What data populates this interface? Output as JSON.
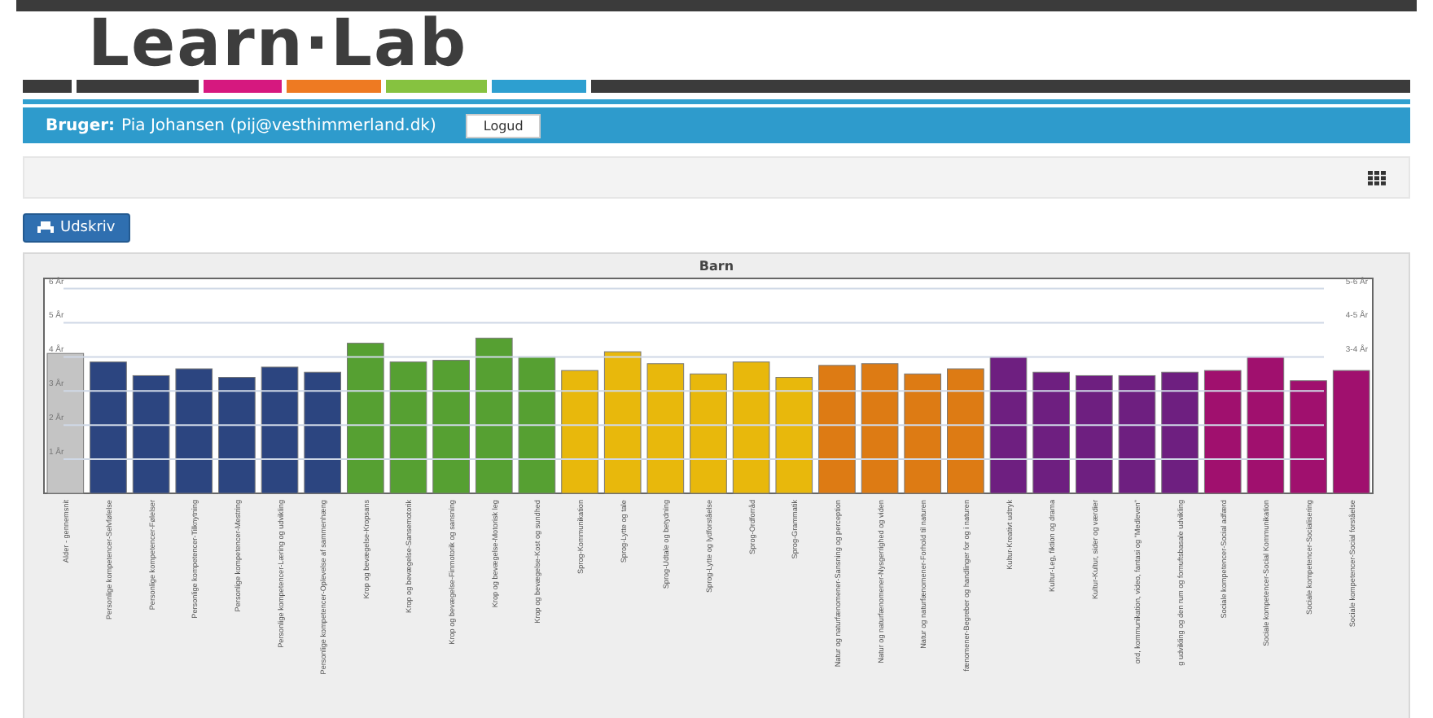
{
  "logo": {
    "text": "Learn·Lab"
  },
  "user_bar": {
    "label": "Bruger:",
    "user": "Pia Johansen (pij@vesthimmerland.dk)",
    "logout_button": "Logud"
  },
  "print_button": {
    "label": "Udskriv"
  },
  "chart_panel": {
    "right_labels": [
      "5-6 År",
      "4-5 År",
      "3-4 År"
    ],
    "chart_data": {
      "type": "bar",
      "title": "Barn",
      "categories": [
        "Alder - gennemsnit",
        "Personlige kompetencer-Selvfølelse",
        "Personlige kompetencer-Følelser",
        "Personlige kompetencer-Tilknytning",
        "Personlige kompetencer-Mestring",
        "Personlige kompetencer-Læring og udvikling",
        "Personlige kompetencer-Oplevelse af sammenhæng",
        "Krop og bevægelse-Kropsans",
        "Krop og bevægelse-Sansemotorik",
        "Krop og bevægelse-Finmotorik og sansning",
        "Krop og bevægelse-Motorisk leg",
        "Krop og bevægelse-Kost og sundhed",
        "Sprog-Kommunikation",
        "Sprog-Lytte og tale",
        "Sprog-Udtale og betydning",
        "Sprog-Lytte og lydforståelse",
        "Sprog-Ordforråd",
        "Sprog-Grammatik",
        "Natur og naturfænomener-Sansning og perception",
        "Natur og naturfænomener-Nysgerrighed og viden",
        "Natur og naturfænomener-Forhold til naturen",
        "fænomener-Begreber og handlinger for og i naturen",
        "Kultur-Kreativt udtryk",
        "Kultur-Leg, fiktion og drama",
        "Kultur-Kultur, sider og værdier",
        "ord, kommunikation, video, fantasi og \"Medleven\"",
        "g udvikling og den rum og fornuftsbasale udvikling",
        "Sociale kompetencer-Social adfærd",
        "Sociale kompetencer-Social Kommunikation",
        "Sociale kompetencer-Socialisering",
        "Sociale kompetencer-Social forståelse"
      ],
      "ylim": [
        0,
        6.3
      ],
      "yticks": [
        {
          "value": 1,
          "label": "1 År"
        },
        {
          "value": 2,
          "label": "2 År"
        },
        {
          "value": 3,
          "label": "3 År"
        },
        {
          "value": 4,
          "label": "4 År"
        },
        {
          "value": 5,
          "label": "5 År"
        },
        {
          "value": 6,
          "label": "6 År"
        }
      ],
      "grid": true,
      "series": [
        {
          "color": "#c4c4c4",
          "values": [
            4.1,
            null,
            null,
            null,
            null,
            null,
            null,
            null,
            null,
            null,
            null,
            null,
            null,
            null,
            null,
            null,
            null,
            null,
            null,
            null,
            null,
            null,
            null,
            null,
            null,
            null,
            null,
            null,
            null,
            null,
            null
          ]
        },
        {
          "color": "#2c4580",
          "values": [
            null,
            3.85,
            3.45,
            3.65,
            3.4,
            3.7,
            3.55,
            null,
            null,
            null,
            null,
            null,
            null,
            null,
            null,
            null,
            null,
            null,
            null,
            null,
            null,
            null,
            null,
            null,
            null,
            null,
            null,
            null,
            null,
            null,
            null
          ]
        },
        {
          "color": "#56a032",
          "values": [
            null,
            null,
            null,
            null,
            null,
            null,
            null,
            4.4,
            3.85,
            3.9,
            4.55,
            4.0,
            null,
            null,
            null,
            null,
            null,
            null,
            null,
            null,
            null,
            null,
            null,
            null,
            null,
            null,
            null,
            null,
            null,
            null,
            null
          ]
        },
        {
          "color": "#e8b80c",
          "values": [
            null,
            null,
            null,
            null,
            null,
            null,
            null,
            null,
            null,
            null,
            null,
            null,
            3.6,
            4.15,
            3.8,
            3.5,
            3.85,
            3.4,
            null,
            null,
            null,
            null,
            null,
            null,
            null,
            null,
            null,
            null,
            null,
            null,
            null
          ]
        },
        {
          "color": "#dd7b14",
          "values": [
            null,
            null,
            null,
            null,
            null,
            null,
            null,
            null,
            null,
            null,
            null,
            null,
            null,
            null,
            null,
            null,
            null,
            null,
            3.75,
            3.8,
            3.5,
            3.65,
            null,
            null,
            null,
            null,
            null,
            null,
            null,
            null,
            null
          ]
        },
        {
          "color": "#6e1f80",
          "values": [
            null,
            null,
            null,
            null,
            null,
            null,
            null,
            null,
            null,
            null,
            null,
            null,
            null,
            null,
            null,
            null,
            null,
            null,
            null,
            null,
            null,
            null,
            4.0,
            3.55,
            3.45,
            3.45,
            3.55,
            null,
            null,
            null,
            null
          ]
        },
        {
          "color": "#a0106e",
          "values": [
            null,
            null,
            null,
            null,
            null,
            null,
            null,
            null,
            null,
            null,
            null,
            null,
            null,
            null,
            null,
            null,
            null,
            null,
            null,
            null,
            null,
            null,
            null,
            null,
            null,
            null,
            null,
            3.6,
            4.0,
            3.3,
            3.6
          ]
        }
      ]
    }
  }
}
